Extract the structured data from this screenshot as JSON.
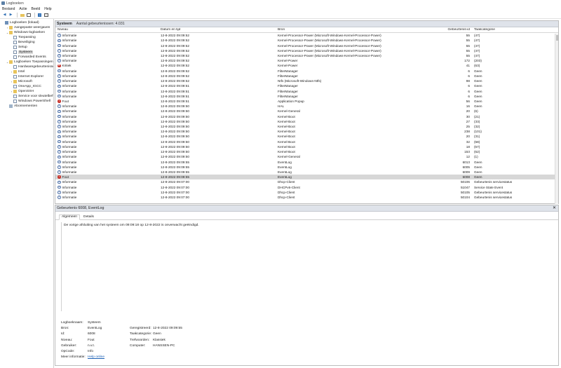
{
  "window": {
    "title": "Logboeken"
  },
  "menu": [
    "Bestand",
    "Actie",
    "Beeld",
    "Help"
  ],
  "toolbar": {
    "icons": [
      "back-arrow-icon",
      "forward-arrow-icon",
      "folder-up-icon",
      "properties-icon",
      "help-icon",
      "console-tree-icon"
    ]
  },
  "tree": [
    {
      "label": "Logboeken (lokaal)",
      "indent": 0,
      "twisty": "",
      "icon": "computer"
    },
    {
      "label": "Aangepaste weergaven",
      "indent": 1,
      "twisty": "›",
      "icon": "folder"
    },
    {
      "label": "Windows-logboeken",
      "indent": 1,
      "twisty": "⌄",
      "icon": "folder"
    },
    {
      "label": "Toepassing",
      "indent": 2,
      "twisty": "",
      "icon": "log"
    },
    {
      "label": "Beveiliging",
      "indent": 2,
      "twisty": "",
      "icon": "log"
    },
    {
      "label": "Setup",
      "indent": 2,
      "twisty": "",
      "icon": "log"
    },
    {
      "label": "Systeem",
      "indent": 2,
      "twisty": "",
      "icon": "log",
      "selected": true
    },
    {
      "label": "Forwarded Events",
      "indent": 2,
      "twisty": "",
      "icon": "log"
    },
    {
      "label": "Logboeken Toepassingen en services",
      "indent": 1,
      "twisty": "⌄",
      "icon": "folder"
    },
    {
      "label": "Hardwaregebeurtenissen",
      "indent": 2,
      "twisty": "",
      "icon": "log"
    },
    {
      "label": "Intel",
      "indent": 2,
      "twisty": "›",
      "icon": "folder"
    },
    {
      "label": "Internet Explorer",
      "indent": 2,
      "twisty": "",
      "icon": "log"
    },
    {
      "label": "Microsoft",
      "indent": 2,
      "twisty": "›",
      "icon": "folder"
    },
    {
      "label": "OneApp_IGCC",
      "indent": 2,
      "twisty": "",
      "icon": "log"
    },
    {
      "label": "OpenSSH",
      "indent": 2,
      "twisty": "›",
      "icon": "folder"
    },
    {
      "label": "Service voor sleutelbeheer",
      "indent": 2,
      "twisty": "",
      "icon": "log"
    },
    {
      "label": "Windows PowerShell",
      "indent": 2,
      "twisty": "",
      "icon": "log"
    },
    {
      "label": "Abonnementen",
      "indent": 1,
      "twisty": "",
      "icon": "sub"
    }
  ],
  "list": {
    "title": "Systeem",
    "count_label": "Aantal gebeurtenissen: 4.031",
    "columns": [
      "Niveau",
      "Datum en tijd",
      "Bron",
      "Gebeurtenis-id",
      "Taakcategorie"
    ],
    "rows": [
      {
        "level": "Informatie",
        "type": "info",
        "date": "12-8-2022 09:09:52",
        "source": "Kernel-Processor-Power (Microsoft-Windows-Kernel-Processor-Power)",
        "id": "55",
        "task": "(47)"
      },
      {
        "level": "Informatie",
        "type": "info",
        "date": "12-8-2022 09:09:52",
        "source": "Kernel-Processor-Power (Microsoft-Windows-Kernel-Processor-Power)",
        "id": "55",
        "task": "(47)"
      },
      {
        "level": "Informatie",
        "type": "info",
        "date": "12-8-2022 09:09:52",
        "source": "Kernel-Processor-Power (Microsoft-Windows-Kernel-Processor-Power)",
        "id": "55",
        "task": "(47)"
      },
      {
        "level": "Informatie",
        "type": "info",
        "date": "12-8-2022 09:09:52",
        "source": "Kernel-Processor-Power (Microsoft-Windows-Kernel-Processor-Power)",
        "id": "55",
        "task": "(47)"
      },
      {
        "level": "Informatie",
        "type": "info",
        "date": "12-8-2022 09:09:52",
        "source": "Kernel-Processor-Power (Microsoft-Windows-Kernel-Processor-Power)",
        "id": "55",
        "task": "(47)"
      },
      {
        "level": "Informatie",
        "type": "info",
        "date": "12-8-2022 09:09:52",
        "source": "Kernel-Power",
        "id": "172",
        "task": "(203)"
      },
      {
        "level": "Kritiek",
        "type": "crit",
        "date": "12-8-2022 09:09:52",
        "source": "Kernel-Power",
        "id": "41",
        "task": "(63)"
      },
      {
        "level": "Informatie",
        "type": "info",
        "date": "12-8-2022 09:09:52",
        "source": "FilterManager",
        "id": "6",
        "task": "Geen"
      },
      {
        "level": "Informatie",
        "type": "info",
        "date": "12-8-2022 09:09:52",
        "source": "FilterManager",
        "id": "6",
        "task": "Geen"
      },
      {
        "level": "Informatie",
        "type": "info",
        "date": "12-8-2022 09:09:52",
        "source": "Ntfs (Microsoft-Windows-Ntfs)",
        "id": "98",
        "task": "Geen"
      },
      {
        "level": "Informatie",
        "type": "info",
        "date": "12-8-2022 09:09:51",
        "source": "FilterManager",
        "id": "6",
        "task": "Geen"
      },
      {
        "level": "Informatie",
        "type": "info",
        "date": "12-8-2022 09:09:51",
        "source": "FilterManager",
        "id": "6",
        "task": "Geen"
      },
      {
        "level": "Informatie",
        "type": "info",
        "date": "12-8-2022 09:09:51",
        "source": "FilterManager",
        "id": "6",
        "task": "Geen"
      },
      {
        "level": "Fout",
        "type": "err",
        "date": "12-8-2022 09:09:51",
        "source": "Application Popup",
        "id": "56",
        "task": "Geen"
      },
      {
        "level": "Informatie",
        "type": "info",
        "date": "12-8-2022 09:09:50",
        "source": "HAL",
        "id": "16",
        "task": "Geen"
      },
      {
        "level": "Informatie",
        "type": "info",
        "date": "12-8-2022 09:09:50",
        "source": "Kernel-General",
        "id": "20",
        "task": "(6)"
      },
      {
        "level": "Informatie",
        "type": "info",
        "date": "12-8-2022 09:09:50",
        "source": "Kernel-Boot",
        "id": "30",
        "task": "(21)"
      },
      {
        "level": "Informatie",
        "type": "info",
        "date": "12-8-2022 09:09:50",
        "source": "Kernel-Boot",
        "id": "27",
        "task": "(33)"
      },
      {
        "level": "Informatie",
        "type": "info",
        "date": "12-8-2022 09:09:50",
        "source": "Kernel-Boot",
        "id": "25",
        "task": "(32)"
      },
      {
        "level": "Informatie",
        "type": "info",
        "date": "12-8-2022 09:09:50",
        "source": "Kernel-Boot",
        "id": "238",
        "task": "(101)"
      },
      {
        "level": "Informatie",
        "type": "info",
        "date": "12-8-2022 09:09:50",
        "source": "Kernel-Boot",
        "id": "20",
        "task": "(31)"
      },
      {
        "level": "Informatie",
        "type": "info",
        "date": "12-8-2022 09:09:50",
        "source": "Kernel-Boot",
        "id": "32",
        "task": "(58)"
      },
      {
        "level": "Informatie",
        "type": "info",
        "date": "12-8-2022 09:09:50",
        "source": "Kernel-Boot",
        "id": "18",
        "task": "(57)"
      },
      {
        "level": "Informatie",
        "type": "info",
        "date": "12-8-2022 09:09:50",
        "source": "Kernel-Boot",
        "id": "153",
        "task": "(62)"
      },
      {
        "level": "Informatie",
        "type": "info",
        "date": "12-8-2022 09:09:50",
        "source": "Kernel-General",
        "id": "12",
        "task": "(1)"
      },
      {
        "level": "Informatie",
        "type": "info",
        "date": "12-8-2022 09:09:55",
        "source": "EventLog",
        "id": "6013",
        "task": "Geen"
      },
      {
        "level": "Informatie",
        "type": "info",
        "date": "12-8-2022 09:09:55",
        "source": "EventLog",
        "id": "6005",
        "task": "Geen"
      },
      {
        "level": "Informatie",
        "type": "info",
        "date": "12-8-2022 09:09:55",
        "source": "EventLog",
        "id": "6009",
        "task": "Geen"
      },
      {
        "level": "Fout",
        "type": "err",
        "date": "12-8-2022 09:09:55",
        "source": "EventLog",
        "id": "6008",
        "task": "Geen",
        "selected": true
      },
      {
        "level": "Informatie",
        "type": "info",
        "date": "12-8-2022 09:07:00",
        "source": "Dhcp-Client",
        "id": "50106",
        "task": "Gebeurtenis servicestatus"
      },
      {
        "level": "Informatie",
        "type": "info",
        "date": "12-8-2022 09:07:00",
        "source": "DHCPv6-Client",
        "id": "51047",
        "task": "Service State Event"
      },
      {
        "level": "Informatie",
        "type": "info",
        "date": "12-8-2022 09:07:00",
        "source": "Dhcp-Client",
        "id": "50105",
        "task": "Gebeurtenis servicestatus"
      },
      {
        "level": "Informatie",
        "type": "info",
        "date": "12-8-2022 09:07:00",
        "source": "Dhcp-Client",
        "id": "50104",
        "task": "Gebeurtenis servicestatus"
      }
    ]
  },
  "detail": {
    "title": "Gebeurtenis 6008, EventLog",
    "close": "✕",
    "tabs": [
      "Algemeen",
      "Details"
    ],
    "description": "De vorige afsluiting van het systeem om 09:09:18 op 12-8-2022 is onverwacht geëindigd.",
    "props": {
      "logboeknaam_k": "Logboeknaam:",
      "logboeknaam_v": "Systeem",
      "bron_k": "Bron:",
      "bron_v": "EventLog",
      "geregistreerd_k": "Geregistreerd:",
      "geregistreerd_v": "12-8-2022 09:09:55",
      "id_k": "Id:",
      "id_v": "6008",
      "taakcat_k": "Taakcategorie:",
      "taakcat_v": "Geen",
      "niveau_k": "Niveau:",
      "niveau_v": "Fout",
      "trefwoorden_k": "Trefwoorden:",
      "trefwoorden_v": "Klassiek",
      "gebruiker_k": "Gebruiker:",
      "gebruiker_v": "n.v.t.",
      "computer_k": "Computer:",
      "computer_v": "HANSSEN-PC",
      "opcode_k": "OpCode:",
      "opcode_v": "Info",
      "meer_k": "Meer informatie:",
      "meer_v": "Help online"
    }
  }
}
